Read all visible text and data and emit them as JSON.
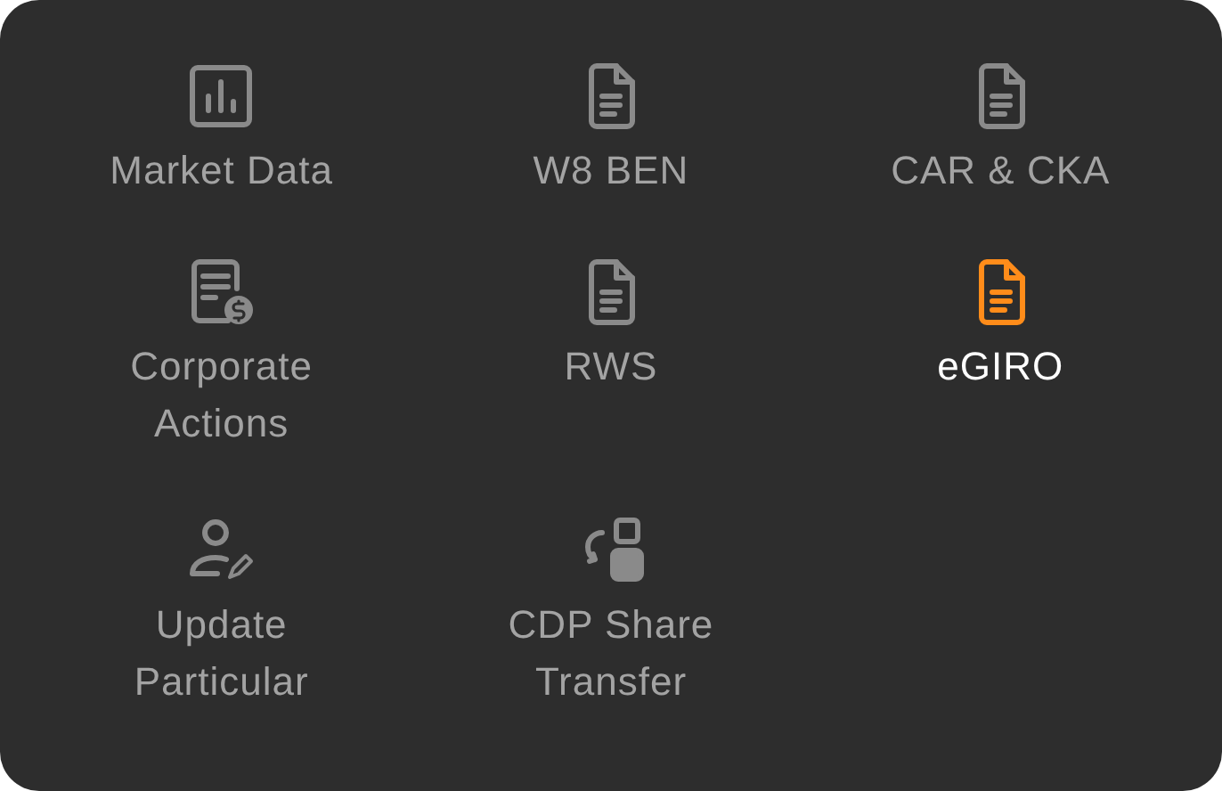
{
  "menu": {
    "items": [
      {
        "label": "Market Data",
        "kind": "chart",
        "selected": false
      },
      {
        "label": "W8 BEN",
        "kind": "document",
        "selected": false
      },
      {
        "label": "CAR & CKA",
        "kind": "document",
        "selected": false
      },
      {
        "label": "Corporate Actions",
        "kind": "receipt",
        "selected": false
      },
      {
        "label": "RWS",
        "kind": "document",
        "selected": false
      },
      {
        "label": "eGIRO",
        "kind": "document",
        "selected": true
      },
      {
        "label": "Update Particular",
        "kind": "person",
        "selected": false
      },
      {
        "label": "CDP Share Transfer",
        "kind": "transfer",
        "selected": false
      }
    ]
  }
}
